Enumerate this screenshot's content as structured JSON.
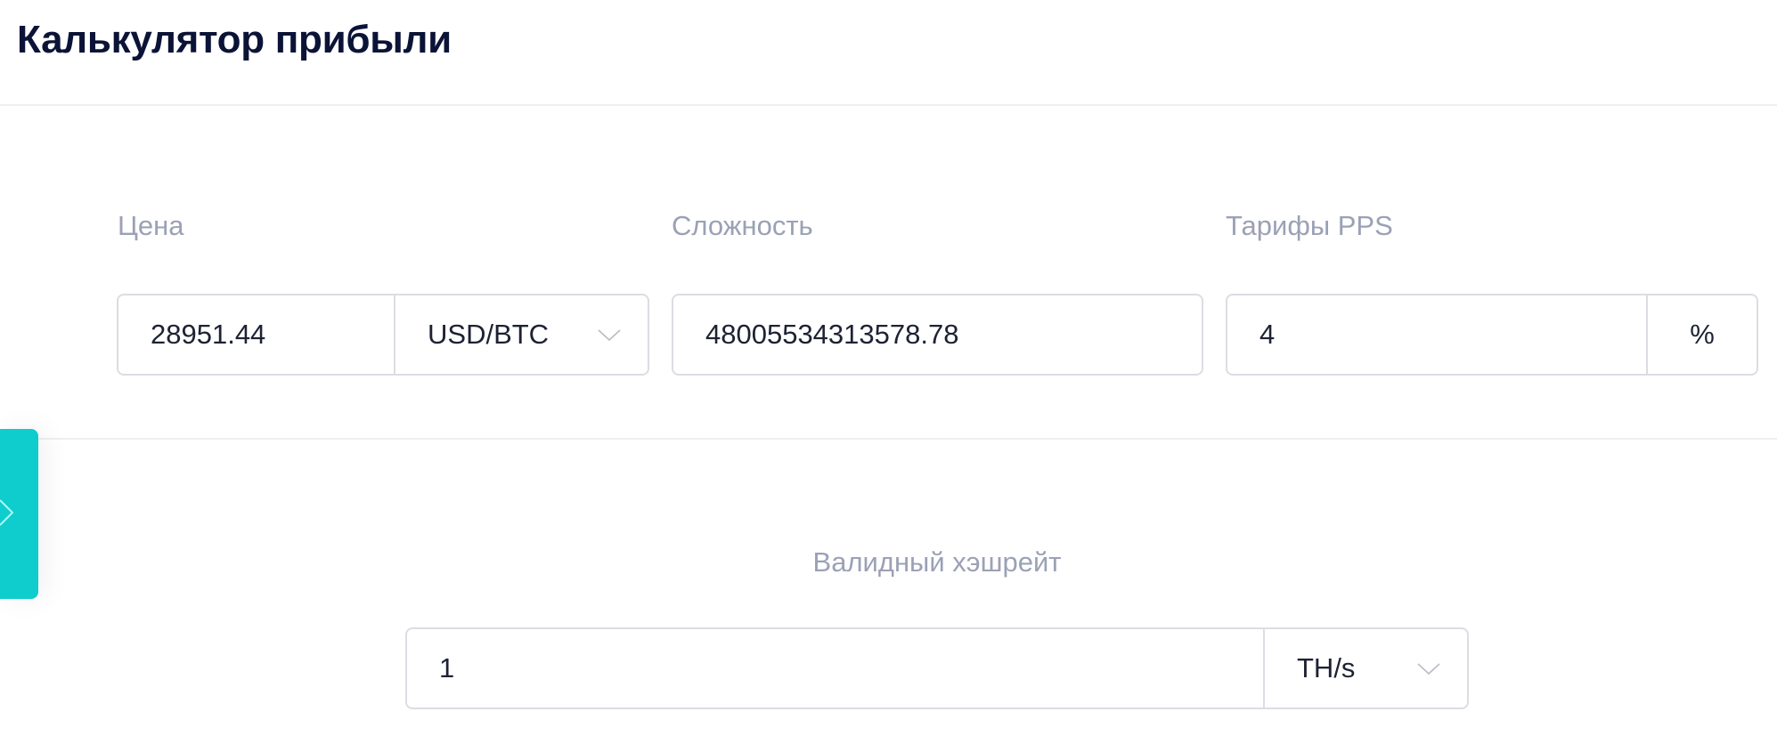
{
  "header": {
    "title": "Калькулятор прибыли"
  },
  "price": {
    "label": "Цена",
    "value": "28951.44",
    "currency": "USD/BTC",
    "currency_icon": "chevron-down-icon"
  },
  "difficulty": {
    "label": "Сложность",
    "value": "48005534313578.78"
  },
  "pps": {
    "label": "Тарифы PPS",
    "value": "4",
    "unit": "%"
  },
  "hashrate": {
    "label": "Валидный хэшрейт",
    "value": "1",
    "unit": "TH/s",
    "unit_icon": "chevron-down-icon"
  },
  "side_tab": {
    "icon": "chevron-right-icon"
  },
  "colors": {
    "title": "#0b1437",
    "label": "#9ba1b5",
    "accent": "#0fcdcd",
    "border": "#dcdde3"
  }
}
